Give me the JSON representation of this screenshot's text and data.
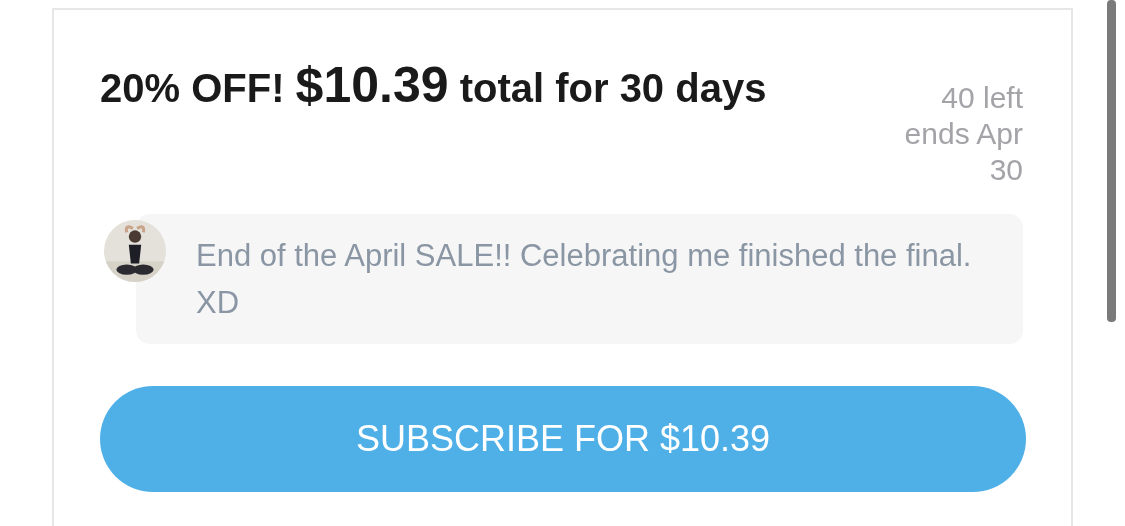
{
  "offer": {
    "prefix": "20% OFF!",
    "price": "$10.39",
    "suffix": "total for 30 days"
  },
  "meta": [
    "40 left",
    "ends Apr 30"
  ],
  "message": {
    "text": "End of the April SALE!! Celebrating me finished the final. XD"
  },
  "subscribe_button": {
    "label": "SUBSCRIBE FOR $10.39"
  }
}
